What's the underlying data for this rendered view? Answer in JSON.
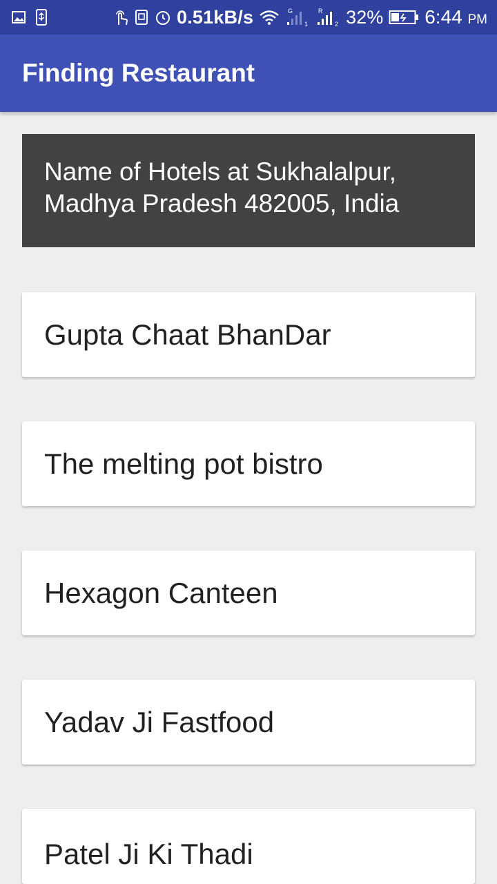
{
  "status_bar": {
    "net_speed": "0.51kB/s",
    "sim1_label": "G",
    "sim1_num": "1",
    "sim2_label": "R",
    "sim2_num": "2",
    "battery": "32%",
    "time": "6:44",
    "ampm": "PM",
    "icons": [
      "image-icon",
      "usb-icon",
      "touch-icon",
      "screenshot-icon",
      "alarm-icon",
      "wifi-icon",
      "signal-icon",
      "battery-icon"
    ]
  },
  "app_bar": {
    "title": "Finding Restaurant"
  },
  "location": {
    "text": "Name of Hotels at Sukhalalpur, Madhya Pradesh 482005, India"
  },
  "restaurants": [
    "Gupta Chaat BhanDar",
    "The melting pot bistro",
    "Hexagon Canteen",
    "Yadav Ji Fastfood",
    "Patel Ji Ki Thadi"
  ],
  "colors": {
    "status_bar": "#30409e",
    "app_bar": "#3f51b5",
    "header_card": "#424242",
    "background": "#eeeeee"
  }
}
